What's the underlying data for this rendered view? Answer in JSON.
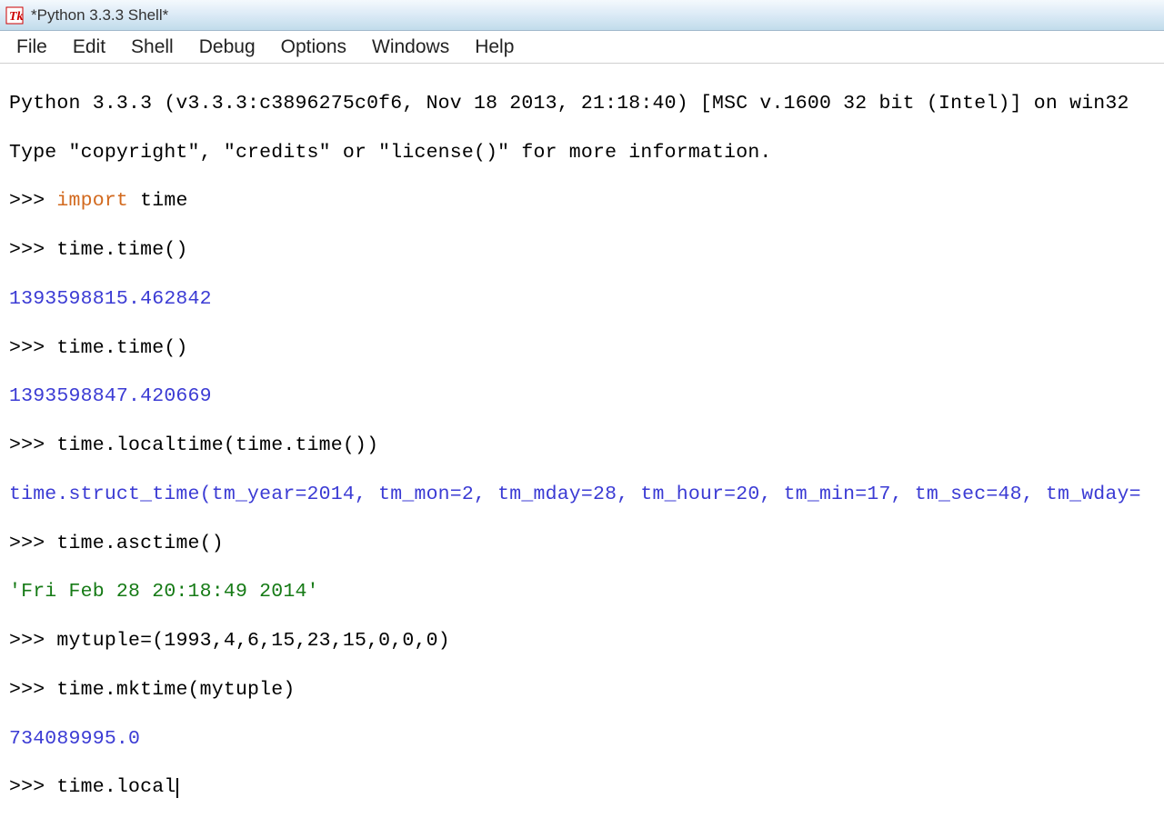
{
  "window": {
    "title": "*Python 3.3.3 Shell*"
  },
  "menubar": {
    "file": "File",
    "edit": "Edit",
    "shell": "Shell",
    "debug": "Debug",
    "options": "Options",
    "windows": "Windows",
    "help": "Help"
  },
  "console": {
    "banner1": "Python 3.3.3 (v3.3.3:c3896275c0f6, Nov 18 2013, 21:18:40) [MSC v.1600 32 bit (Intel)] on win32",
    "banner2": "Type \"copyright\", \"credits\" or \"license()\" for more information.",
    "prompt": ">>> ",
    "entries": {
      "l1_kw": "import",
      "l1_rest": " time",
      "l2": "time.time()",
      "o2": "1393598815.462842",
      "l3": "time.time()",
      "o3": "1393598847.420669",
      "l4": "time.localtime(time.time())",
      "o4": "time.struct_time(tm_year=2014, tm_mon=2, tm_mday=28, tm_hour=20, tm_min=17, tm_sec=48, tm_wday=",
      "l5": "time.asctime()",
      "o5": "'Fri Feb 28 20:18:49 2014'",
      "l6": "mytuple=(1993,4,6,15,23,15,0,0,0)",
      "l7": "time.mktime(mytuple)",
      "o7": "734089995.0",
      "l8": "time.local"
    }
  }
}
